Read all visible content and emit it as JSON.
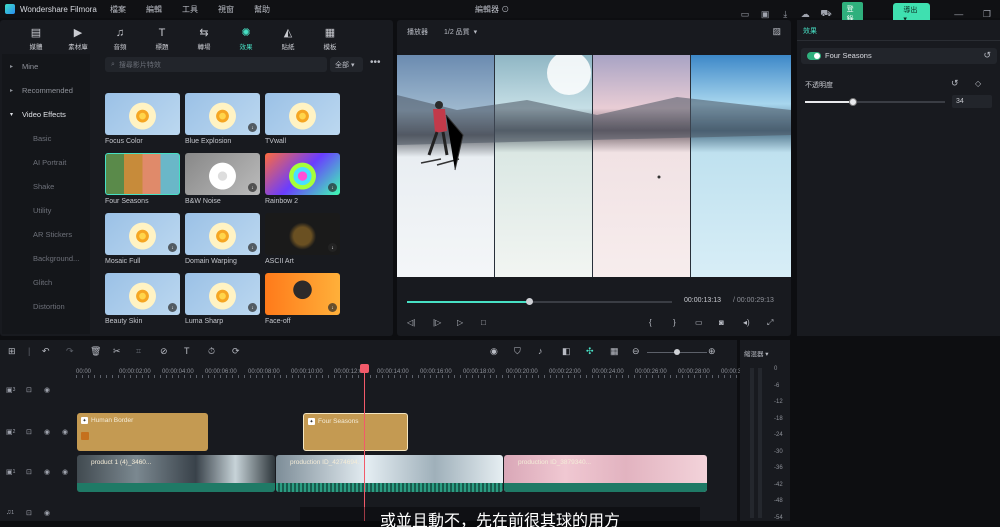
{
  "app": {
    "name": "Wondershare Filmora",
    "project_title": "編輯器"
  },
  "menus": [
    "檔案",
    "編輯",
    "工具",
    "視窗",
    "幫助"
  ],
  "titlebar": {
    "login_label": "登錄",
    "export_label": "導出"
  },
  "tooltabs": [
    {
      "label": "媒體",
      "icon": "media-icon"
    },
    {
      "label": "素材庫",
      "icon": "stock-icon"
    },
    {
      "label": "音頻",
      "icon": "music-icon"
    },
    {
      "label": "標題",
      "icon": "title-icon"
    },
    {
      "label": "轉場",
      "icon": "transition-icon"
    },
    {
      "label": "效果",
      "icon": "effects-icon",
      "active": true
    },
    {
      "label": "貼紙",
      "icon": "sticker-icon"
    },
    {
      "label": "模板",
      "icon": "template-icon"
    }
  ],
  "categories": {
    "mine": "Mine",
    "recommended": "Recommended",
    "video_effects": "Video Effects",
    "subs": [
      "Basic",
      "AI Portrait",
      "Shake",
      "Utility",
      "AR Stickers",
      "Background...",
      "Glitch",
      "Distortion"
    ]
  },
  "search": {
    "placeholder": "搜尋影片特效",
    "filter": "全部"
  },
  "effects": [
    {
      "label": "Focus Color",
      "kind": "flower"
    },
    {
      "label": "Blue Explosion",
      "kind": "flower"
    },
    {
      "label": "TVwall",
      "kind": "flower"
    },
    {
      "label": "Four Seasons",
      "kind": "seasons"
    },
    {
      "label": "B&W Noise",
      "kind": "bw"
    },
    {
      "label": "Rainbow 2",
      "kind": "rainbow"
    },
    {
      "label": "Mosaic Full",
      "kind": "flower"
    },
    {
      "label": "Domain Warping",
      "kind": "flower"
    },
    {
      "label": "ASCII Art",
      "kind": "ascii"
    },
    {
      "label": "Beauty Skin",
      "kind": "flower"
    },
    {
      "label": "Luma Sharp",
      "kind": "flower"
    },
    {
      "label": "Face-off",
      "kind": "face"
    }
  ],
  "preview": {
    "label": "播放器",
    "quality": "1/2 品質",
    "current_time": "00:00:13:13",
    "duration": "/ 00:00:29:13",
    "progress": 0.46
  },
  "inspector": {
    "tab": "效果",
    "effect_name": "Four Seasons",
    "opacity_label": "不透明度",
    "opacity_value": "34",
    "opacity_fraction": 0.34
  },
  "timeline": {
    "ruler": [
      "00:00",
      "00:00:02:00",
      "00:00:04:00",
      "00:00:06:00",
      "00:00:08:00",
      "00:00:10:00",
      "00:00:12:00",
      "00:00:14:00",
      "00:00:16:00",
      "00:00:18:00",
      "00:00:20:00",
      "00:00:22:00",
      "00:00:24:00",
      "00:00:26:00",
      "00:00:28:00",
      "00:00:30"
    ],
    "fx_clips": [
      "Human Border",
      "Four Seasons"
    ],
    "video_clips": [
      "product 1 (4)_3460...",
      "production ID_4274694...",
      "production ID_3879340..."
    ],
    "track_labels": [
      "3",
      "2",
      "1",
      "1"
    ]
  },
  "audio_meter": {
    "label": "縮混器",
    "db": [
      "0",
      "-6",
      "-12",
      "-18",
      "-24",
      "-30",
      "-36",
      "-42",
      "-48",
      "-54"
    ]
  },
  "subtitle": "或並且動不，先在前很其球的用方"
}
